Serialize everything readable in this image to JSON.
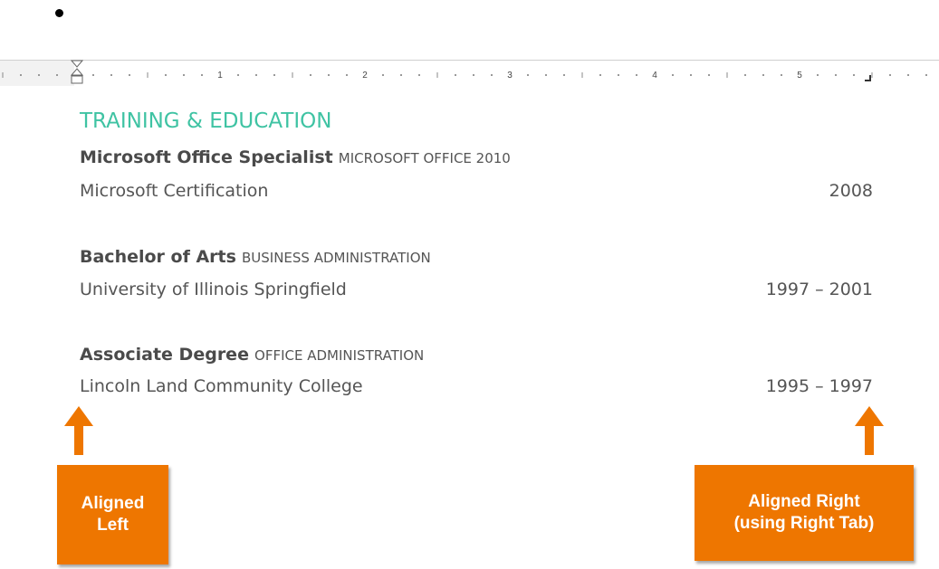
{
  "ruler": {
    "numbers": [
      "1",
      "2",
      "3",
      "4",
      "5"
    ]
  },
  "section": {
    "title": "TRAINING & EDUCATION"
  },
  "entries": [
    {
      "degree": "Microsoft Office Specialist",
      "field": "MICROSOFT OFFICE 2010",
      "institution": "Microsoft Certification",
      "years": "2008"
    },
    {
      "degree": "Bachelor of Arts",
      "field": "BUSINESS ADMINISTRATION",
      "institution": "University of Illinois Springfield",
      "years": "1997 – 2001"
    },
    {
      "degree": "Associate Degree",
      "field": "OFFICE ADMINISTRATION",
      "institution": "Lincoln Land Community College",
      "years": "1995 – 1997"
    }
  ],
  "callouts": {
    "left": {
      "line1": "Aligned",
      "line2": "Left"
    },
    "right": {
      "line1": "Aligned Right",
      "line2": "(using Right Tab)"
    }
  },
  "colors": {
    "accent": "#3fc3a3",
    "callout": "#ee7600",
    "text": "#555555"
  }
}
